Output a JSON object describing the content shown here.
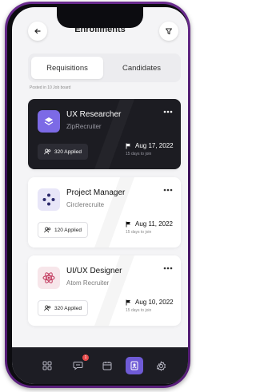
{
  "header": {
    "title": "Enrollments"
  },
  "tabs": [
    {
      "label": "Requisitions",
      "active": true
    },
    {
      "label": "Candidates",
      "active": false
    }
  ],
  "posted_note": "Posted in 10 Job board",
  "jobs": [
    {
      "title": "UX Researcher",
      "company": "ZipRecruiter",
      "applied": "320 Applied",
      "date": "Aug 17, 2022",
      "days": "15 days to join",
      "theme": "dark",
      "logo_color": "#7c6ae6"
    },
    {
      "title": "Project Manager",
      "company": "Circlerecruite",
      "applied": "120 Applied",
      "date": "Aug 11, 2022",
      "days": "15 days to join",
      "theme": "light",
      "logo_color": "#e8e6f8"
    },
    {
      "title": "UI/UX Designer",
      "company": "Atom Recruiter",
      "applied": "320 Applied",
      "date": "Aug 10, 2022",
      "days": "15 days to join",
      "theme": "light",
      "logo_color": "#f7e6ea"
    }
  ],
  "bottom_nav": [
    {
      "icon": "grid-icon",
      "active": false
    },
    {
      "icon": "chat-icon",
      "active": false,
      "badge": "1"
    },
    {
      "icon": "calendar-icon",
      "active": false
    },
    {
      "icon": "badge-icon",
      "active": true
    },
    {
      "icon": "settings-icon",
      "active": false
    }
  ],
  "colors": {
    "accent": "#6f5bd6",
    "frame": "#5a1f7c",
    "dark_card": "#1c1c22",
    "badge": "#e94b4b"
  }
}
